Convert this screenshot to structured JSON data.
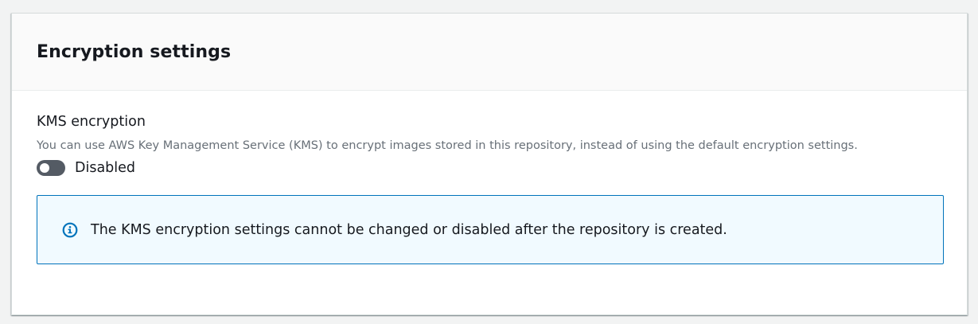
{
  "panel": {
    "title": "Encryption settings"
  },
  "kms": {
    "label": "KMS encryption",
    "description": "You can use AWS Key Management Service (KMS) to encrypt images stored in this repository, instead of using the default encryption settings.",
    "toggle_state": "off",
    "toggle_label": "Disabled"
  },
  "info": {
    "icon": "info-icon",
    "message": "The KMS encryption settings cannot be changed or disabled after the repository is created.",
    "accent_color": "#0073bb",
    "background_color": "#f1faff"
  }
}
